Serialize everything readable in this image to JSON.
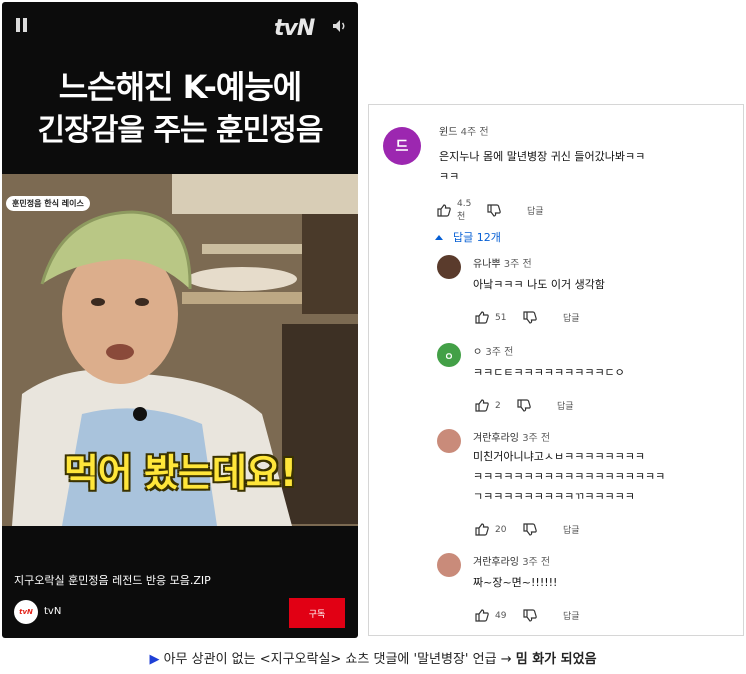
{
  "video": {
    "channel_logo": "tvN",
    "title_line1": "느슨해진 K-예능에",
    "title_line2": "긴장감을 주는 훈민정음",
    "tag": "훈민정음 한식 레이스",
    "caption": "먹어 봤는데요!",
    "footer_title": "지구오락실 훈민정음 레전드 반응 모음.ZIP",
    "channel_avatar_text": "tvN",
    "channel_name": "tvN",
    "subscribe_label": "구독",
    "icons": {
      "pause": "pause-icon",
      "volume": "speaker-icon"
    }
  },
  "comments": {
    "top": {
      "avatar_letter": "드",
      "avatar_color": "#9c27b0",
      "author": "윈드",
      "time": "4주 전",
      "text_line1": "은지누나 몸에 말년병장 귀신 들어갔나봐ㅋㅋ",
      "text_line2": "ㅋㅋ",
      "likes": "4.5천",
      "reply_label": "답글"
    },
    "replies_toggle": "답글 12개",
    "replies": [
      {
        "author": "유나뿌",
        "time": "3주 전",
        "text_lines": [
          "아낰ㅋㅋㅋ 나도 이거 생각함"
        ],
        "likes": "51",
        "reply_label": "답글",
        "avatar_color": "#5a3b2c"
      },
      {
        "author": "ㅇ",
        "time": "3주 전",
        "text_lines": [
          "ㅋㅋㄷㅌㅋㅋㅋㅋㅋㅋㅋㅋㅋㄷㅇ"
        ],
        "likes": "2",
        "reply_label": "답글",
        "avatar_color": "#43a047"
      },
      {
        "author": "겨란후라잉",
        "time": "3주 전",
        "text_lines": [
          "미친거아니냐고ㅅㅂㅋㅋㅋㅋㅋㅋㅋㅋ",
          "ㅋㅋㅋㅋㅋㅋㅋㅋㅋㅋㅋㅋㅋㅋㅋㅋㅋㅋㅋ",
          "ㄱㅋㅋㅋㅋㅋㅋㅋㅋㅋㄲㅋㅋㅋㅋㅋ"
        ],
        "likes": "20",
        "reply_label": "답글",
        "avatar_color": "#c98b7a"
      },
      {
        "author": "겨란후라잉",
        "time": "3주 전",
        "text_lines": [
          "짜~장~면~!!!!!!"
        ],
        "likes": "49",
        "reply_label": "답글",
        "avatar_color": "#c98b7a"
      }
    ]
  },
  "bottom_caption": {
    "arrow": "▶",
    "text": "아무 상관이 없는 <지구오락실> 쇼츠 댓글에 '말년병장' 언급",
    "arrow2": "→",
    "bold": "밈 화가 되었음"
  }
}
